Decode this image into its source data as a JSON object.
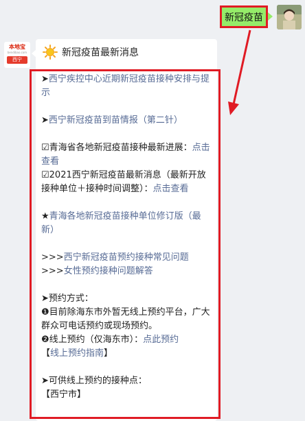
{
  "sent": {
    "text": "新冠疫苗"
  },
  "bot": {
    "brand": "本地宝",
    "brand_sub": "bendibao.com",
    "city": "西宁"
  },
  "card": {
    "title": "新冠疫苗最新消息",
    "items": {
      "l1_prefix": "➤",
      "l1_link": "西宁疾控中心近期新冠疫苗接种安排与提示",
      "l2_prefix": "➤",
      "l2_link": "西宁新冠疫苗到苗情报（第二针）",
      "l3_text": "☑青海省各地新冠疫苗接种最新进展：",
      "l3_link": "点击查看",
      "l4_text": "☑2021西宁新冠疫苗最新消息（最新开放接种单位＋接种时间调整）：",
      "l4_link": "点击查看",
      "l5_prefix": "★",
      "l5_link": "青海各地新冠疫苗接种单位修订版（最新）",
      "l6_prefix": ">>>",
      "l6_link": "西宁新冠疫苗预约接种常见问题",
      "l7_prefix": ">>>",
      "l7_link": "女性预约接种问题解答",
      "l8_text": "➤预约方式：",
      "l9_text": "❶目前除海东市外暂无线上预约平台，广大群众可电话预约或现场预约。",
      "l10_text": "❷线上预约（仅海东市）：",
      "l10_link": "点此预约",
      "l11_open": "【",
      "l11_link": "线上预约指南",
      "l11_close": "】",
      "l12_text": "➤可供线上预约的接种点：",
      "l13_text": "【西宁市】"
    }
  },
  "colors": {
    "link": "#576b95",
    "sent_bubble": "#95ec69",
    "highlight": "#e01b24"
  },
  "icons": {
    "header": "sun-icon"
  }
}
